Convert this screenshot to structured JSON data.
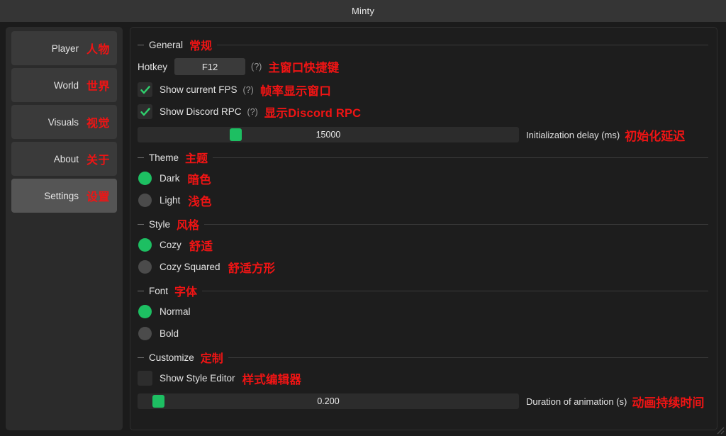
{
  "window": {
    "title": "Minty"
  },
  "sidebar": {
    "items": [
      {
        "label": "Player",
        "cn": "人物",
        "selected": false
      },
      {
        "label": "World",
        "cn": "世界",
        "selected": false
      },
      {
        "label": "Visuals",
        "cn": "视觉",
        "selected": false
      },
      {
        "label": "About",
        "cn": "关于",
        "selected": false
      },
      {
        "label": "Settings",
        "cn": "设置",
        "selected": true
      }
    ]
  },
  "colors": {
    "accent_green": "#1dbf62",
    "annotation_red": "#f01414",
    "panel_bg": "#1d1d1d",
    "sidebar_bg": "#2b2b2b",
    "titlebar_bg": "#353535",
    "selected_nav": "#555555"
  },
  "sections": {
    "general": {
      "title": "General",
      "cn": "常规",
      "hotkey": {
        "label": "Hotkey",
        "value": "F12",
        "help": "(?)",
        "cn": "主窗口快捷键"
      },
      "show_fps": {
        "label": "Show current FPS",
        "checked": true,
        "help": "(?)",
        "cn": "帧率显示窗口"
      },
      "show_discord_rpc": {
        "label": "Show Discord RPC",
        "checked": true,
        "help": "(?)",
        "cn": "显示Discord RPC"
      },
      "init_delay": {
        "value": "15000",
        "label": "Initialization delay (ms)",
        "cn": "初始化延迟",
        "fill_percent": 25
      }
    },
    "theme": {
      "title": "Theme",
      "cn": "主题",
      "options": [
        {
          "label": "Dark",
          "cn": "暗色",
          "selected": true
        },
        {
          "label": "Light",
          "cn": "浅色",
          "selected": false
        }
      ]
    },
    "style": {
      "title": "Style",
      "cn": "风格",
      "options": [
        {
          "label": "Cozy",
          "cn": "舒适",
          "selected": true
        },
        {
          "label": "Cozy Squared",
          "cn": "舒适方形",
          "selected": false
        }
      ]
    },
    "font": {
      "title": "Font",
      "cn": "字体",
      "options": [
        {
          "label": "Normal",
          "cn": "",
          "selected": true
        },
        {
          "label": "Bold",
          "cn": "",
          "selected": false
        }
      ]
    },
    "customize": {
      "title": "Customize",
      "cn": "定制",
      "show_style_editor": {
        "label": "Show Style Editor",
        "checked": false,
        "cn": "样式编辑器"
      },
      "animation_duration": {
        "value": "0.200",
        "label": "Duration of animation (s)",
        "cn": "动画持续时间",
        "fill_percent": 4
      }
    }
  }
}
